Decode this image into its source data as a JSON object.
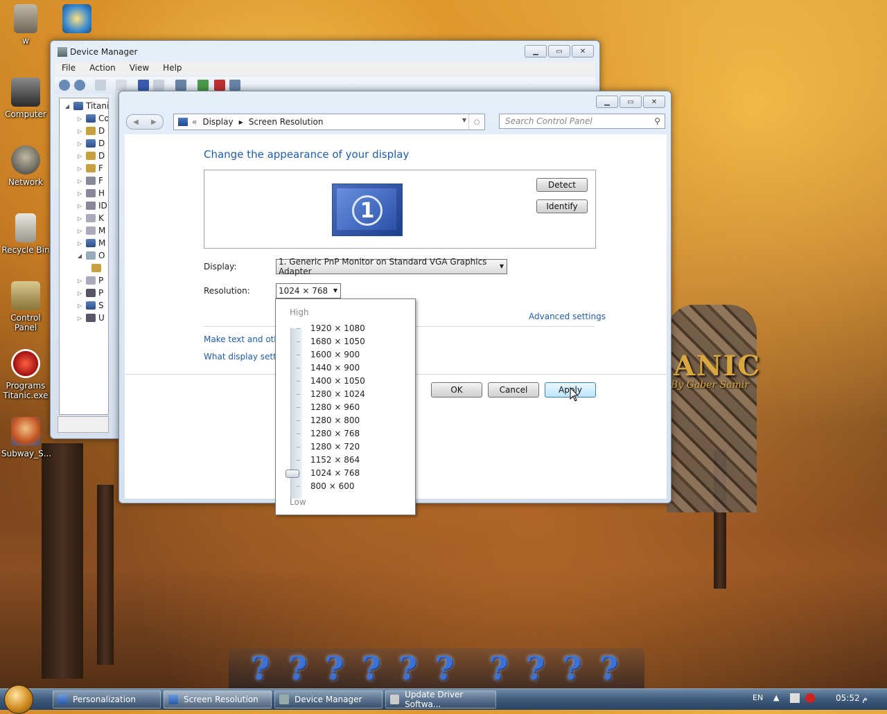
{
  "desktop": {
    "icons": [
      {
        "label": "w"
      },
      {
        "label": ""
      },
      {
        "label": "Computer"
      },
      {
        "label": "Network"
      },
      {
        "label": "Recycle Bin"
      },
      {
        "label": "Control Panel"
      },
      {
        "label": "Programs Titanic.exe"
      },
      {
        "label": "Subway_S..."
      }
    ],
    "wallpaper_title": "ANIC",
    "wallpaper_sub": "By Gaber Samir"
  },
  "device_manager": {
    "title": "Device Manager",
    "menu": [
      "File",
      "Action",
      "View",
      "Help"
    ],
    "tree": [
      {
        "label": "Titanic_"
      },
      {
        "label": "Com"
      },
      {
        "label": "D"
      },
      {
        "label": "D"
      },
      {
        "label": "D"
      },
      {
        "label": "F"
      },
      {
        "label": "F"
      },
      {
        "label": "H"
      },
      {
        "label": "ID"
      },
      {
        "label": "K"
      },
      {
        "label": "M"
      },
      {
        "label": "M"
      },
      {
        "label": "O"
      },
      {
        "label": ""
      },
      {
        "label": "P"
      },
      {
        "label": "P"
      },
      {
        "label": "S"
      },
      {
        "label": "U"
      }
    ]
  },
  "screen_resolution": {
    "breadcrumb": {
      "sep": "«",
      "item1": "Display",
      "item2": "Screen Resolution"
    },
    "search_placeholder": "Search Control Panel",
    "heading": "Change the appearance of your display",
    "monitor_number": "1",
    "detect": "Detect",
    "identify": "Identify",
    "display_label": "Display:",
    "display_value": "1. Generic PnP Monitor on Standard VGA Graphics Adapter",
    "resolution_label": "Resolution:",
    "resolution_value": "1024 × 768",
    "advanced": "Advanced settings",
    "link1": "Make text and other",
    "link2": "What display setting",
    "ok": "OK",
    "cancel": "Cancel",
    "apply": "Apply"
  },
  "resolution_menu": {
    "high": "High",
    "low": "Low",
    "options": [
      "1920 × 1080",
      "1680 × 1050",
      "1600 × 900",
      "1440 × 900",
      "1400 × 1050",
      "1280 × 1024",
      "1280 × 960",
      "1280 × 800",
      "1280 × 768",
      "1280 × 720",
      "1152 × 864",
      "1024 × 768",
      "800 × 600"
    ],
    "selected": "1024 × 768"
  },
  "taskbar": {
    "items": [
      "Personalization",
      "Screen Resolution",
      "Device Manager",
      "Update Driver Softwa..."
    ],
    "lang": "EN",
    "clock": "05:52 م"
  }
}
